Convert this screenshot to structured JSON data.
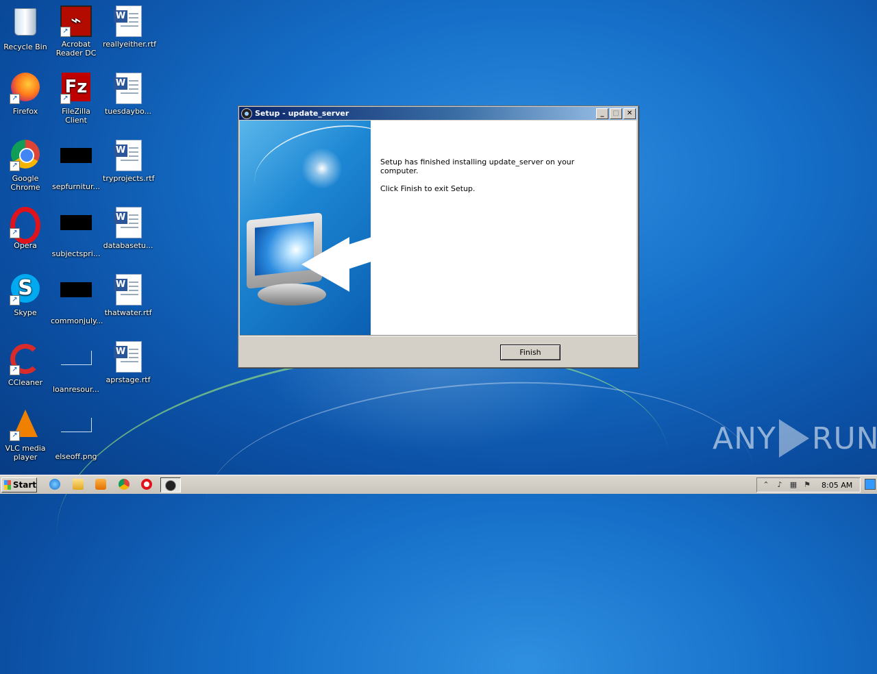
{
  "desktop": {
    "icons": [
      {
        "label": "Recycle Bin"
      },
      {
        "label": "Acrobat Reader DC"
      },
      {
        "label": "reallyeither.rtf"
      },
      {
        "label": "Firefox"
      },
      {
        "label": "FileZilla Client"
      },
      {
        "label": "tuesdaybo..."
      },
      {
        "label": "Google Chrome"
      },
      {
        "label": "sepfurnitur..."
      },
      {
        "label": "tryprojects.rtf"
      },
      {
        "label": "Opera"
      },
      {
        "label": "subjectspri..."
      },
      {
        "label": "databasetu..."
      },
      {
        "label": "Skype"
      },
      {
        "label": "commonjuly..."
      },
      {
        "label": "thatwater.rtf"
      },
      {
        "label": "CCleaner"
      },
      {
        "label": "loanresour..."
      },
      {
        "label": "aprstage.rtf"
      },
      {
        "label": "VLC media player"
      },
      {
        "label": "elseoff.png"
      }
    ]
  },
  "dialog": {
    "title": "Setup - update_server",
    "message_line1": "Setup has finished installing update_server on your computer.",
    "message_line2": "Click Finish to exit Setup.",
    "finish_label": "Finish",
    "min_glyph": "_",
    "max_glyph": "□",
    "close_glyph": "✕"
  },
  "watermark": {
    "left": "ANY",
    "right": "RUN"
  },
  "taskbar": {
    "start_label": "Start",
    "clock": "8:05 AM",
    "tray_expand": "⌃"
  }
}
